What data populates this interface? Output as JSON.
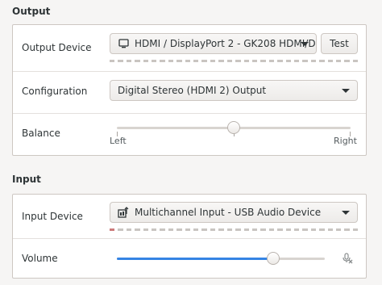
{
  "output": {
    "section_title": "Output",
    "device": {
      "label": "Output Device",
      "value": "HDMI / DisplayPort 2 - GK208 HDMI/D…",
      "icon": "monitor-icon",
      "test_button": "Test"
    },
    "configuration": {
      "label": "Configuration",
      "value": "Digital Stereo (HDMI 2) Output"
    },
    "balance": {
      "label": "Balance",
      "left_label": "Left",
      "right_label": "Right",
      "value": 0.5
    }
  },
  "input": {
    "section_title": "Input",
    "device": {
      "label": "Input Device",
      "value": "Multichannel Input - USB Audio Device",
      "icon": "usb-audio-icon"
    },
    "volume": {
      "label": "Volume",
      "value": 0.75,
      "icon": "microphone-muted-icon"
    }
  },
  "colors": {
    "accent": "#3584e4",
    "background": "#f6f5f4",
    "frame": "#ffffff"
  }
}
